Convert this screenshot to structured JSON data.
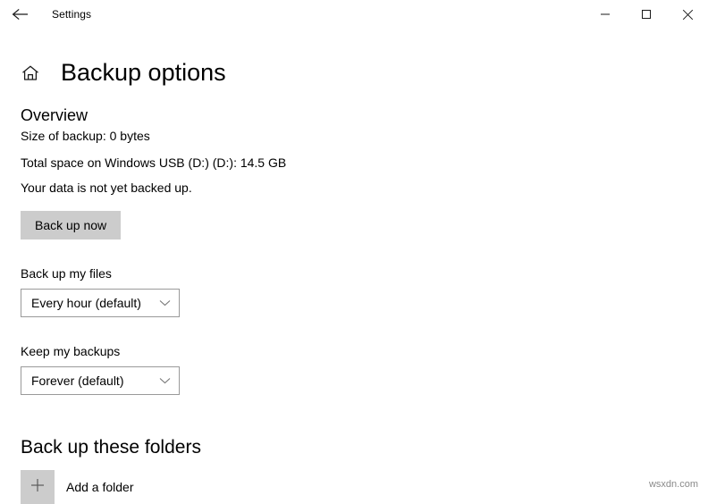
{
  "window": {
    "title": "Settings",
    "back_icon": "arrow-left-icon",
    "controls": {
      "minimize": "minimize-icon",
      "maximize": "maximize-icon",
      "close": "close-icon"
    }
  },
  "header": {
    "home_icon": "home-icon",
    "title": "Backup options"
  },
  "overview": {
    "heading": "Overview",
    "size_of_backup": "Size of backup: 0 bytes",
    "total_space": "Total space on Windows USB (D:) (D:): 14.5 GB",
    "status": "Your data is not yet backed up.",
    "backup_now_label": "Back up now"
  },
  "backup_frequency": {
    "label": "Back up my files",
    "value": "Every hour (default)",
    "chevron_icon": "chevron-down-icon"
  },
  "keep_backups": {
    "label": "Keep my backups",
    "value": "Forever (default)",
    "chevron_icon": "chevron-down-icon"
  },
  "folders": {
    "heading": "Back up these folders",
    "add_icon": "plus-icon",
    "add_label": "Add a folder"
  },
  "watermark": "wsxdn.com",
  "colors": {
    "page_background": "#ffffff",
    "button_fill": "#cccccc",
    "combo_border": "#9a9a9a",
    "text": "#000000",
    "watermark_text": "#8a8a8a"
  }
}
